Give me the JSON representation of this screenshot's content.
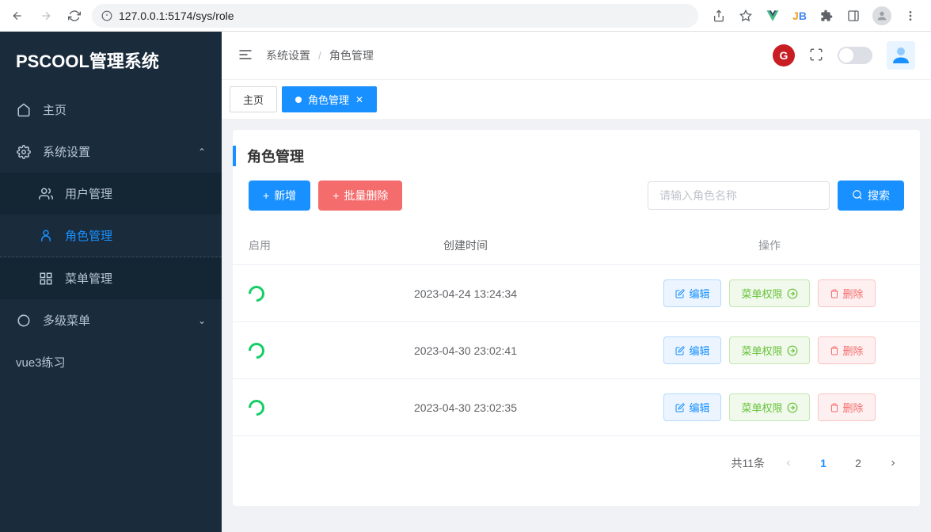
{
  "browser": {
    "url": "127.0.0.1:5174/sys/role"
  },
  "app": {
    "logo": "PSCOOL管理系统"
  },
  "sidebar": {
    "items": [
      {
        "label": "主页"
      },
      {
        "label": "系统设置"
      },
      {
        "label": "用户管理"
      },
      {
        "label": "角色管理"
      },
      {
        "label": "菜单管理"
      },
      {
        "label": "多级菜单"
      },
      {
        "label": "vue3练习"
      }
    ]
  },
  "breadcrumb": {
    "item1": "系统设置",
    "item2": "角色管理"
  },
  "tabs": {
    "home": "主页",
    "role": "角色管理"
  },
  "page": {
    "title": "角色管理",
    "addBtn": "新增",
    "batchDelBtn": "批量删除",
    "searchPlaceholder": "请输入角色名称",
    "searchBtn": "搜索"
  },
  "table": {
    "headers": {
      "enable": "启用",
      "createTime": "创建时间",
      "ops": "操作"
    },
    "opLabels": {
      "edit": "编辑",
      "perm": "菜单权限",
      "del": "删除"
    },
    "rows": [
      {
        "time": "2023-04-24 13:24:34"
      },
      {
        "time": "2023-04-30 23:02:41"
      },
      {
        "time": "2023-04-30 23:02:35"
      }
    ]
  },
  "pagination": {
    "total": "共11条",
    "page1": "1",
    "page2": "2"
  }
}
